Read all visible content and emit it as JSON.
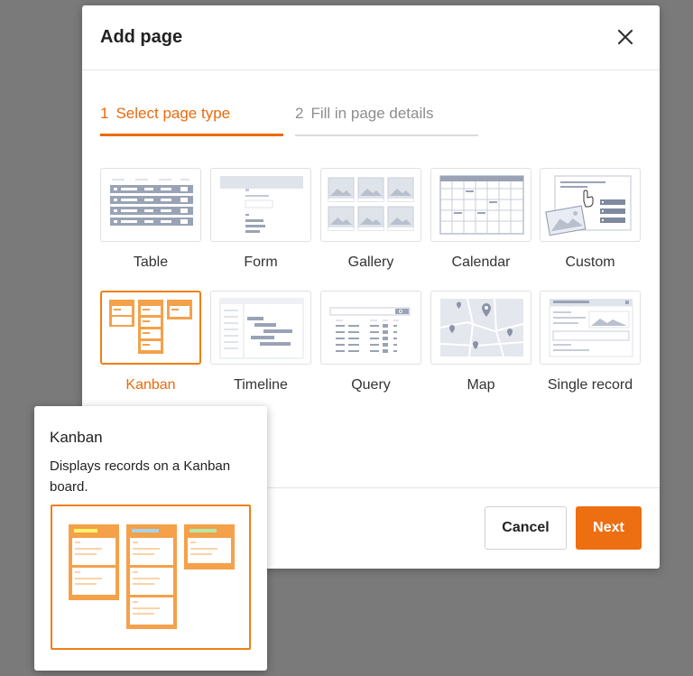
{
  "dialog": {
    "title": "Add page",
    "close_icon": "close-icon"
  },
  "steps": [
    {
      "number": "1",
      "label": "Select page type",
      "active": true
    },
    {
      "number": "2",
      "label": "Fill in page details",
      "active": false
    }
  ],
  "page_types": [
    {
      "label": "Table",
      "icon": "table-icon",
      "selected": false
    },
    {
      "label": "Form",
      "icon": "form-icon",
      "selected": false
    },
    {
      "label": "Gallery",
      "icon": "gallery-icon",
      "selected": false
    },
    {
      "label": "Calendar",
      "icon": "calendar-icon",
      "selected": false
    },
    {
      "label": "Custom",
      "icon": "custom-icon",
      "selected": false
    },
    {
      "label": "Kanban",
      "icon": "kanban-icon",
      "selected": true
    },
    {
      "label": "Timeline",
      "icon": "timeline-icon",
      "selected": false
    },
    {
      "label": "Query",
      "icon": "query-icon",
      "selected": false
    },
    {
      "label": "Map",
      "icon": "map-icon",
      "selected": false
    },
    {
      "label": "Single record",
      "icon": "single-record-icon",
      "selected": false
    }
  ],
  "buttons": {
    "cancel": "Cancel",
    "next": "Next"
  },
  "tooltip": {
    "title": "Kanban",
    "description": "Displays records on a Kanban board.",
    "preview_icon": "kanban-preview-icon"
  },
  "colors": {
    "accent": "#ee6e12",
    "overlay": "#7a7a7a",
    "icon_gray": "#9aa3b5"
  }
}
